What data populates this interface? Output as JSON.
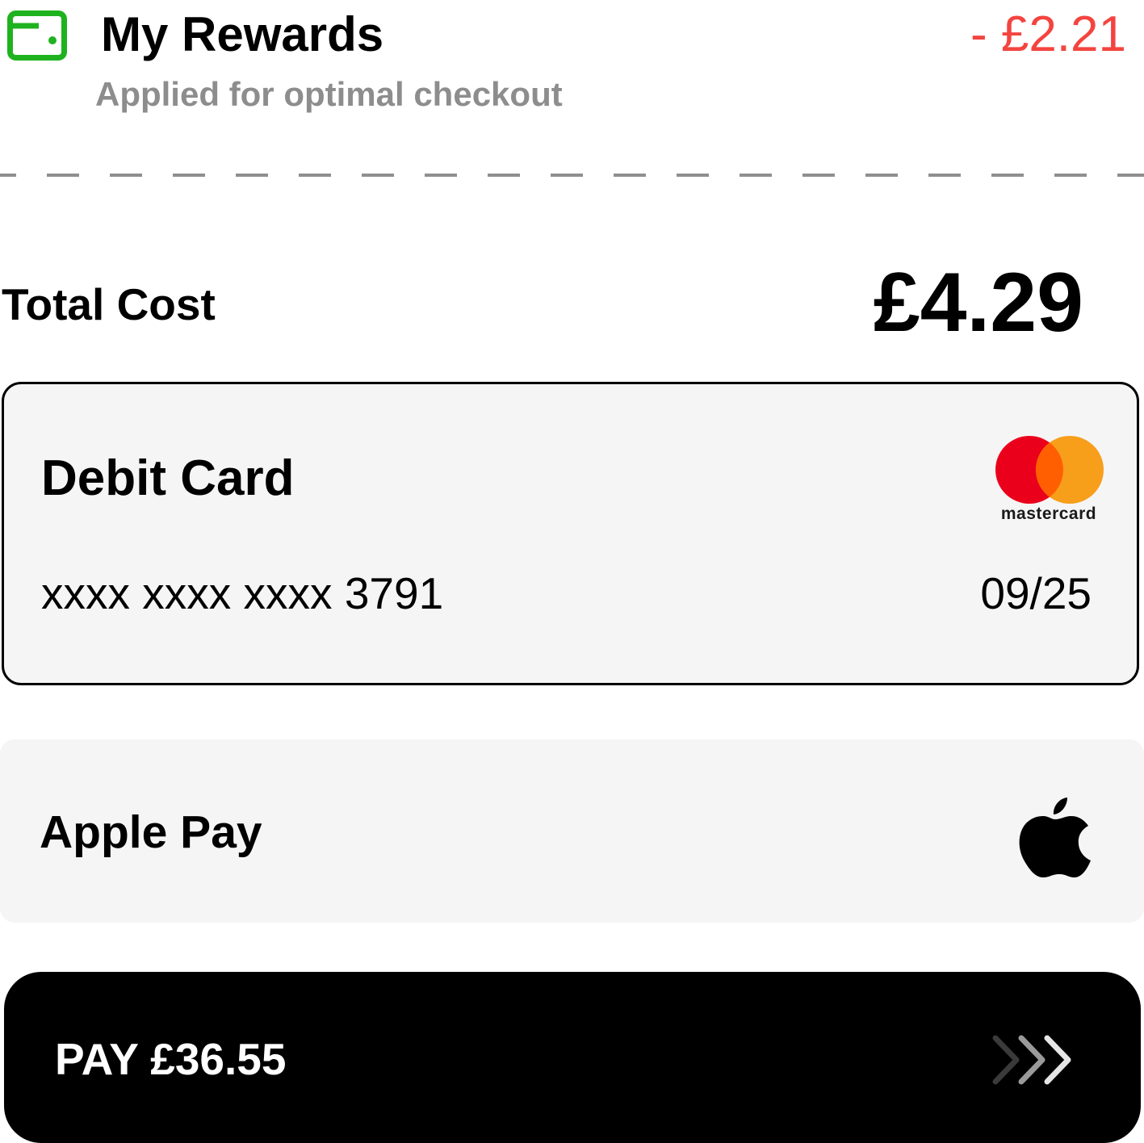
{
  "rewards": {
    "title": "My Rewards",
    "subtitle": "Applied for optimal checkout",
    "amount": "- £2.21",
    "icon": "wallet-icon",
    "icon_color": "#1fb21f",
    "amount_color": "#f4443f"
  },
  "total": {
    "label": "Total Cost",
    "value": "£4.29"
  },
  "payment_methods": [
    {
      "name": "Debit Card",
      "number": "xxxx xxxx xxxx 3791",
      "expiry": "09/25",
      "brand": "mastercard",
      "selected": true
    },
    {
      "name": "Apple Pay",
      "icon": "apple-icon",
      "selected": false
    }
  ],
  "pay_button": {
    "label": "PAY £36.55",
    "icon": "triple-chevron-right-icon"
  },
  "colors": {
    "card_background": "#f5f5f5",
    "button_background": "#000000",
    "mastercard_red": "#eb001b",
    "mastercard_orange": "#f79e1b",
    "mastercard_overlap": "#ff5f00"
  }
}
